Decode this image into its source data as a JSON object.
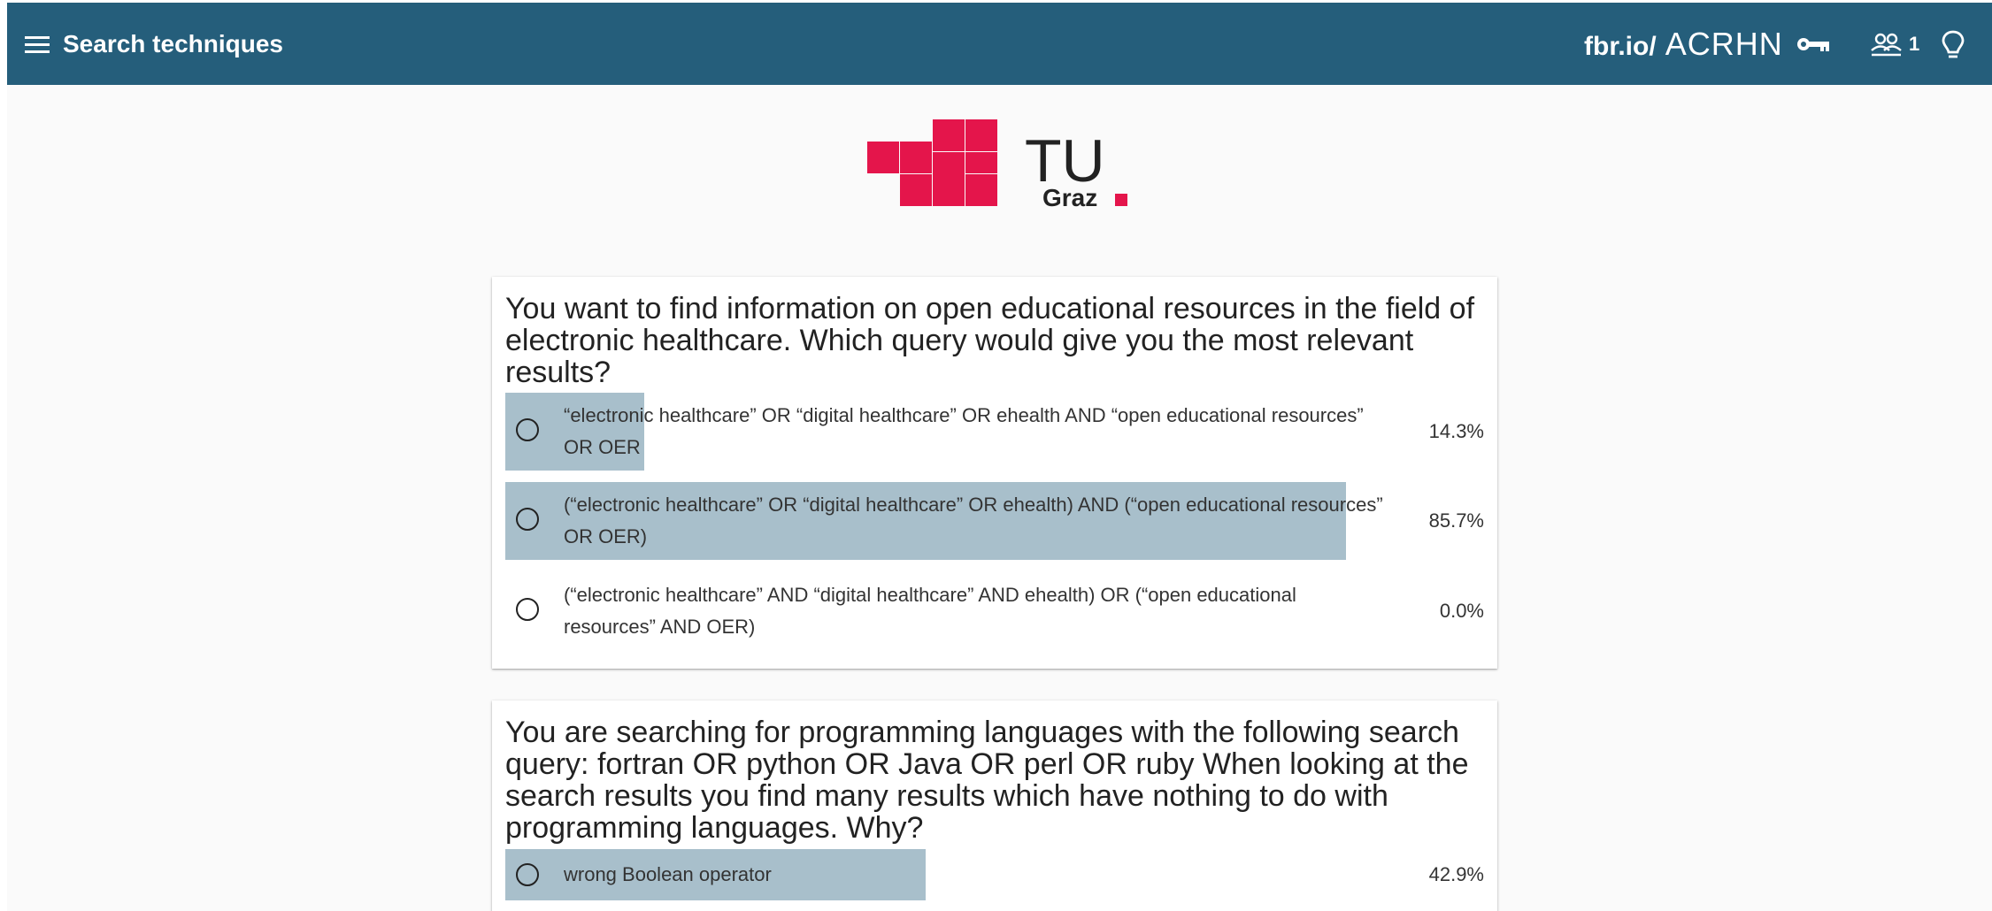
{
  "header": {
    "title": "Search techniques",
    "session_prefix": "fbr.io/",
    "session_code": "ACRHN",
    "user_count": "1",
    "background": "#255e7b"
  },
  "logo": {
    "text_main": "TU",
    "text_sub": "Graz",
    "color": "#e4154b"
  },
  "questions": [
    {
      "text": "You want to find information on open educational resources in the field of electronic healthcare. Which query would give you the most relevant results?",
      "options": [
        {
          "text": "“electronic healthcare” OR “digital healthcare” OR ehealth AND “open educational resources” OR OER",
          "percent": "14.3%",
          "share": 0.143
        },
        {
          "text": "(“electronic healthcare” OR “digital healthcare” OR ehealth) AND (“open educational resources” OR OER)",
          "percent": "85.7%",
          "share": 0.857
        },
        {
          "text": "(“electronic healthcare” AND “digital healthcare” AND ehealth) OR (“open educational resources” AND OER)",
          "percent": "0.0%",
          "share": 0.0
        }
      ]
    },
    {
      "text": "You are searching for programming languages with the following search query: fortran OR python OR Java OR perl OR ruby When looking at the search results you find many results which have nothing to do with programming languages. Why?",
      "options": [
        {
          "text": "wrong Boolean operator",
          "percent": "42.9%",
          "share": 0.429
        }
      ]
    }
  ],
  "colors": {
    "result_bar": "#a8bfcb"
  }
}
